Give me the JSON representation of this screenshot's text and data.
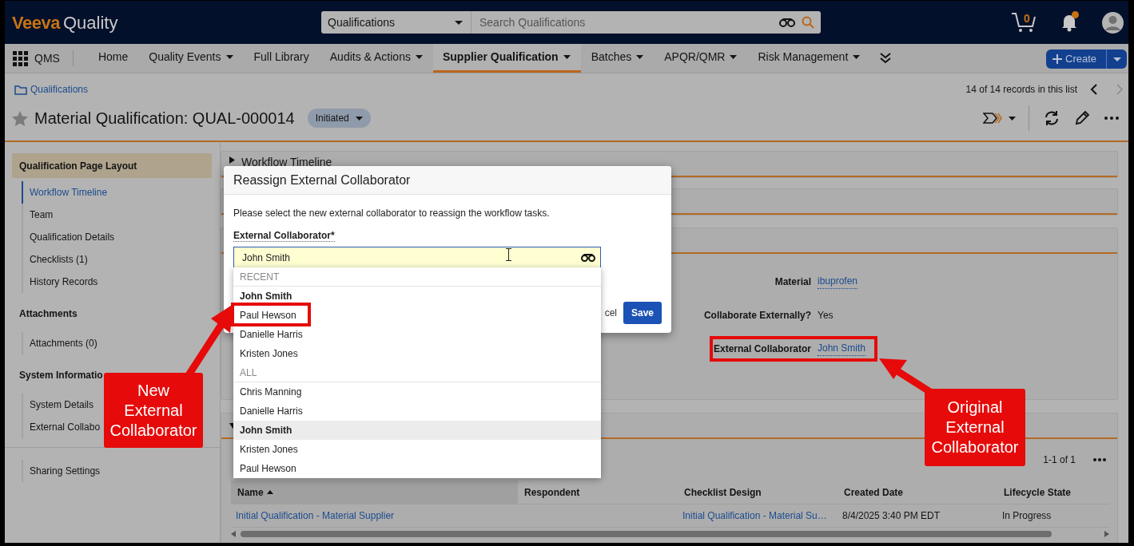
{
  "header": {
    "brand": "Veeva",
    "product": "Quality",
    "search_scope": "Qualifications",
    "search_placeholder": "Search Qualifications",
    "cart_count": "0",
    "notifications_unread": true
  },
  "nav": {
    "app": "QMS",
    "items": [
      {
        "label": "Home",
        "dropdown": false,
        "selected": false
      },
      {
        "label": "Quality Events",
        "dropdown": true,
        "selected": false
      },
      {
        "label": "Full Library",
        "dropdown": false,
        "selected": false
      },
      {
        "label": "Audits & Actions",
        "dropdown": true,
        "selected": false
      },
      {
        "label": "Supplier Qualification",
        "dropdown": true,
        "selected": true
      },
      {
        "label": "Batches",
        "dropdown": true,
        "selected": false
      },
      {
        "label": "APQR/QMR",
        "dropdown": true,
        "selected": false
      },
      {
        "label": "Risk Management",
        "dropdown": true,
        "selected": false
      }
    ],
    "create_button": "Create"
  },
  "breadcrumb": "Qualifications",
  "record_position": "14 of 14 records in this list",
  "record": {
    "title": "Material Qualification: QUAL-000014",
    "state": "Initiated"
  },
  "sidebar": {
    "sections": [
      {
        "title": "Qualification Page Layout",
        "highlighted": true,
        "items": [
          {
            "label": "Workflow Timeline",
            "selected": true
          },
          {
            "label": "Team",
            "selected": false
          },
          {
            "label": "Qualification Details",
            "selected": false
          },
          {
            "label": "Checklists (1)",
            "selected": false
          },
          {
            "label": "History Records",
            "selected": false
          }
        ]
      },
      {
        "title": "Attachments",
        "highlighted": false,
        "items": [
          {
            "label": "Attachments (0)",
            "selected": false
          }
        ]
      },
      {
        "title": "System Informatio",
        "highlighted": false,
        "items": [
          {
            "label": "System Details",
            "selected": false
          },
          {
            "label": "External Collabo",
            "selected": false
          }
        ]
      },
      {
        "items": [
          {
            "label": "Sharing Settings",
            "selected": false
          }
        ]
      }
    ]
  },
  "workflow_panel": {
    "title": "Workflow Timeline",
    "expanded": false
  },
  "details_fields": [
    {
      "label": "Material",
      "value": "ibuprofen",
      "kind": "link"
    },
    {
      "label": "Collaborate Externally?",
      "value": "Yes",
      "kind": "text"
    },
    {
      "label": "External Collaborator",
      "value": "John Smith",
      "kind": "link"
    }
  ],
  "checklists": {
    "expanded": true,
    "count": "1-1 of 1",
    "columns": [
      {
        "label": "Name",
        "sorted": true
      },
      {
        "label": "Respondent",
        "sorted": false
      },
      {
        "label": "Checklist Design",
        "sorted": false
      },
      {
        "label": "Created Date",
        "sorted": false
      },
      {
        "label": "Lifecycle State",
        "sorted": false
      }
    ],
    "rows": [
      {
        "name": "Initial Qualification - Material Supplier",
        "checklist_design": "Initial Qualification - Material Su…",
        "created_date": "8/4/2025 3:40 PM EDT",
        "lifecycle_state": "In Progress"
      }
    ]
  },
  "modal": {
    "title": "Reassign External Collaborator",
    "message": "Please select the new external collaborator to reassign the workflow tasks.",
    "field_label": "External Collaborator*",
    "field_value": "John Smith",
    "groups": [
      {
        "label": "RECENT",
        "options": [
          {
            "label": "John Smith",
            "selected": true,
            "hovered": false
          },
          {
            "label": "Paul Hewson",
            "selected": false,
            "hovered": false
          },
          {
            "label": "Danielle Harris",
            "selected": false,
            "hovered": false
          },
          {
            "label": "Kristen Jones",
            "selected": false,
            "hovered": false
          }
        ]
      },
      {
        "label": "ALL",
        "options": [
          {
            "label": "Chris Manning",
            "selected": false,
            "hovered": false
          },
          {
            "label": "Danielle Harris",
            "selected": false,
            "hovered": false
          },
          {
            "label": "John Smith",
            "selected": true,
            "hovered": true
          },
          {
            "label": "Kristen Jones",
            "selected": false,
            "hovered": false
          },
          {
            "label": "Paul Hewson",
            "selected": false,
            "hovered": false
          }
        ]
      }
    ],
    "buttons": [
      {
        "label": "cel",
        "kind": "link"
      },
      {
        "label": "Save",
        "kind": "primary"
      }
    ]
  },
  "annotations": [
    {
      "text": "New External Collaborator"
    },
    {
      "text": "Original External Collaborator"
    }
  ]
}
